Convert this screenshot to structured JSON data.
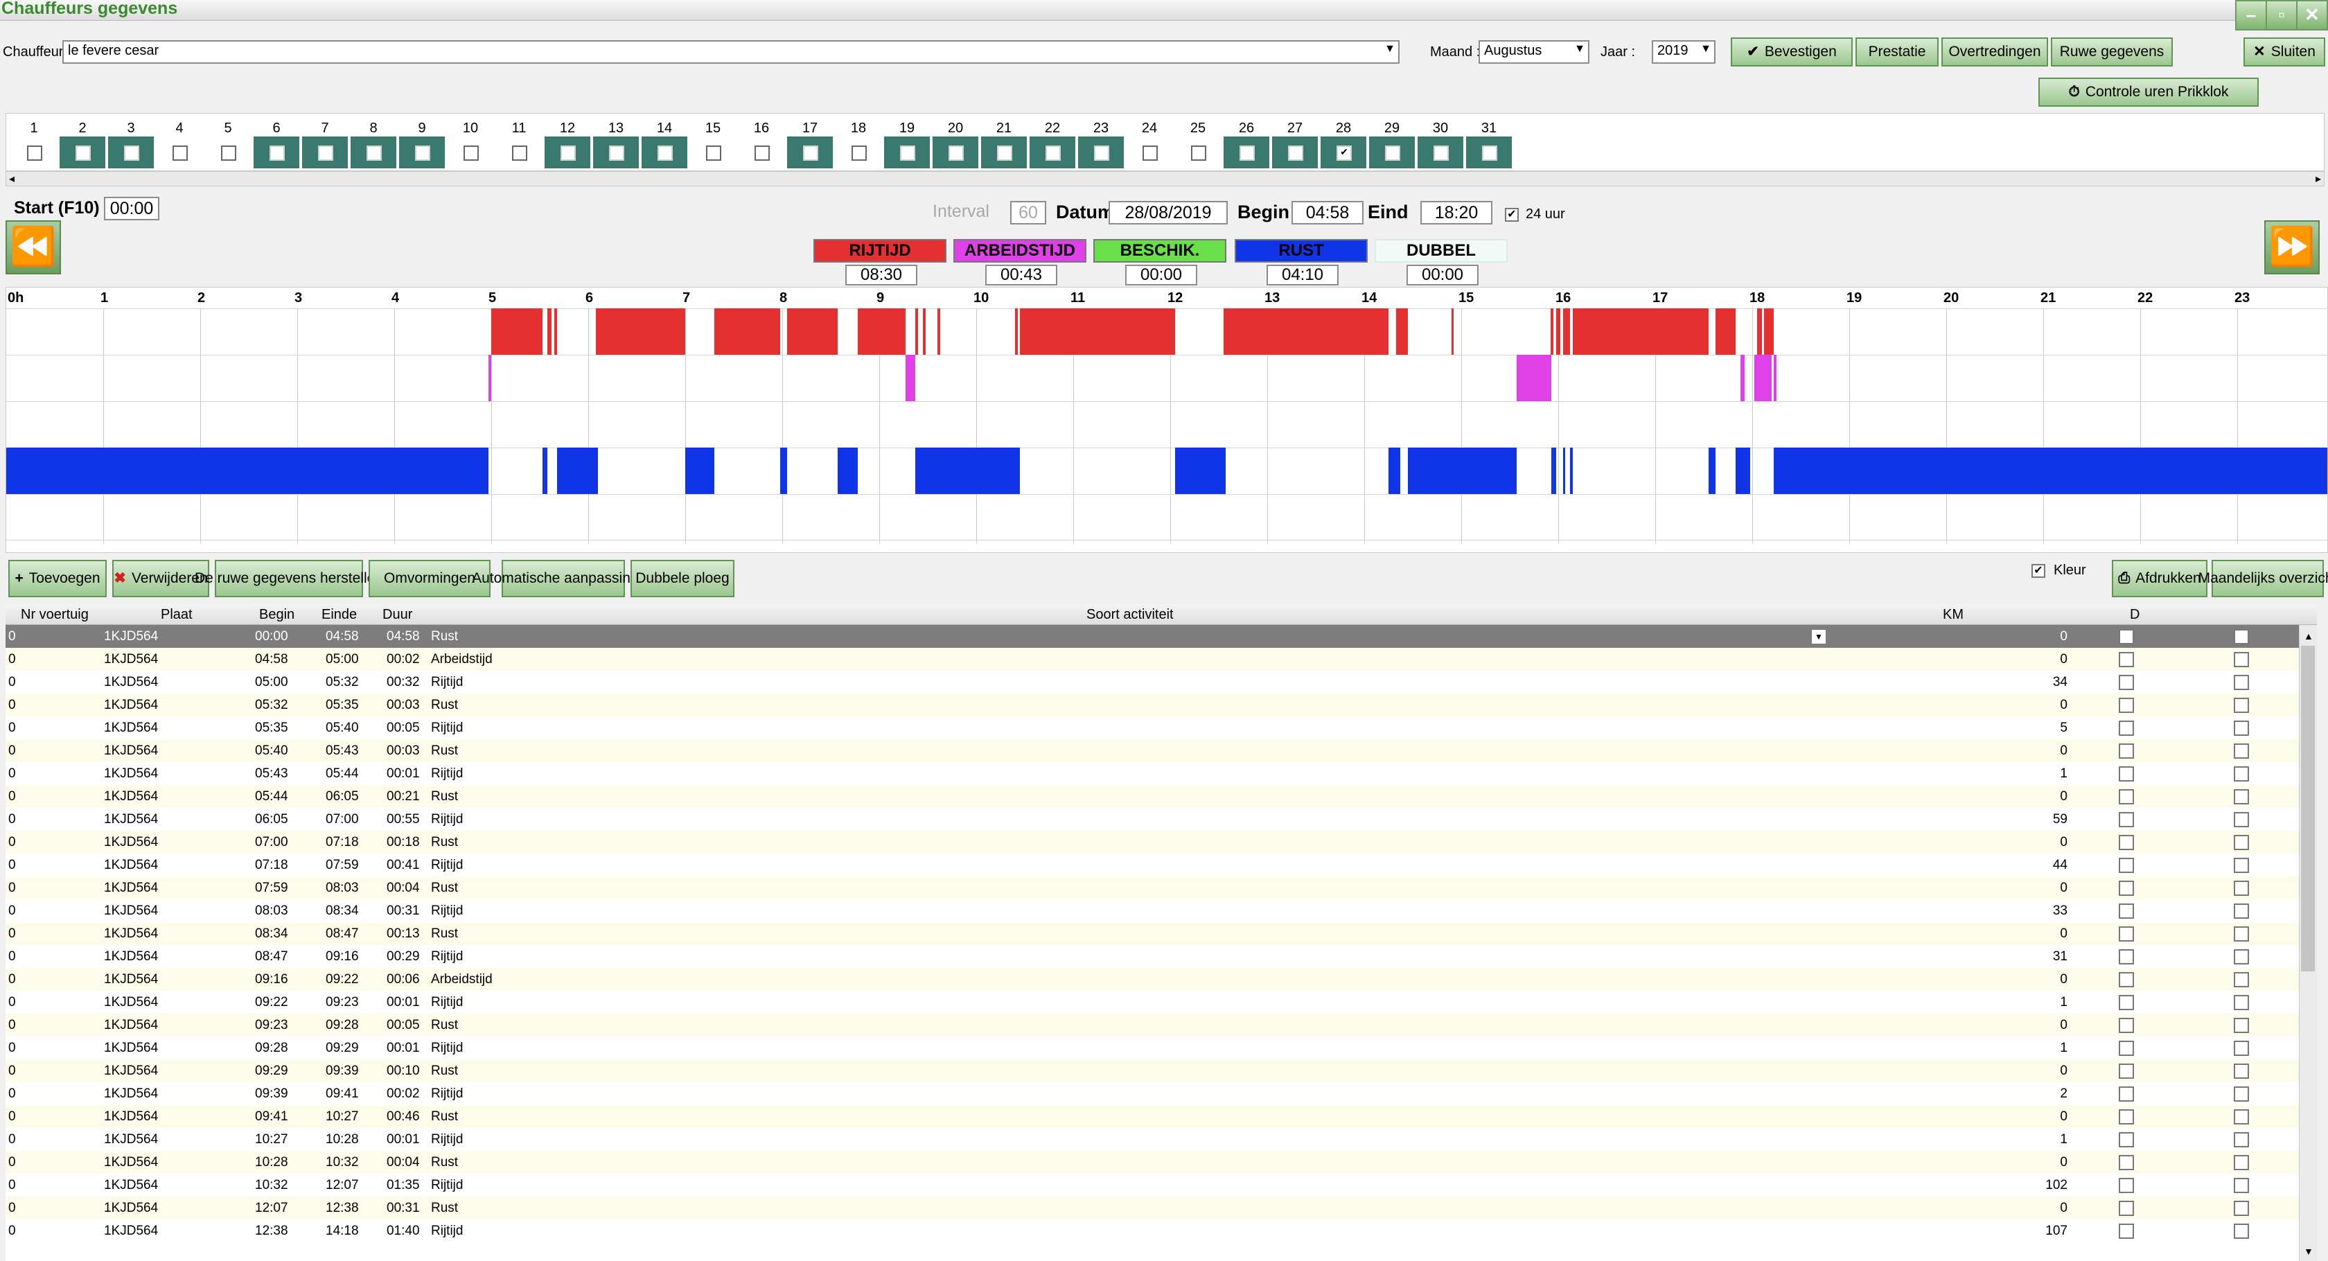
{
  "window": {
    "title": "Chauffeurs gegevens",
    "min_icon": "minimize-icon",
    "max_icon": "maximize-icon",
    "close_icon": "close-icon"
  },
  "header": {
    "chauffeur_label": "Chauffeur",
    "chauffeur_value": "le fevere cesar",
    "maand_label": "Maand :",
    "maand_value": "Augustus",
    "jaar_label": "Jaar :",
    "jaar_value": "2019",
    "btn_bevestigen": "Bevestigen",
    "btn_prestatie": "Prestatie",
    "btn_overtredingen": "Overtredingen",
    "btn_ruwe": "Ruwe gegevens",
    "btn_sluiten": "Sluiten",
    "btn_controle": "Controle uren Prikklok"
  },
  "days": [
    {
      "n": "1",
      "on": false
    },
    {
      "n": "2",
      "on": true
    },
    {
      "n": "3",
      "on": true
    },
    {
      "n": "4",
      "on": false
    },
    {
      "n": "5",
      "on": false
    },
    {
      "n": "6",
      "on": true
    },
    {
      "n": "7",
      "on": true
    },
    {
      "n": "8",
      "on": true
    },
    {
      "n": "9",
      "on": true
    },
    {
      "n": "10",
      "on": false
    },
    {
      "n": "11",
      "on": false
    },
    {
      "n": "12",
      "on": true
    },
    {
      "n": "13",
      "on": true
    },
    {
      "n": "14",
      "on": true
    },
    {
      "n": "15",
      "on": false
    },
    {
      "n": "16",
      "on": false
    },
    {
      "n": "17",
      "on": true
    },
    {
      "n": "18",
      "on": false
    },
    {
      "n": "19",
      "on": true
    },
    {
      "n": "20",
      "on": true
    },
    {
      "n": "21",
      "on": true
    },
    {
      "n": "22",
      "on": true
    },
    {
      "n": "23",
      "on": true
    },
    {
      "n": "24",
      "on": false
    },
    {
      "n": "25",
      "on": false
    },
    {
      "n": "26",
      "on": true
    },
    {
      "n": "27",
      "on": true
    },
    {
      "n": "28",
      "on": true,
      "checked": true
    },
    {
      "n": "29",
      "on": true
    },
    {
      "n": "30",
      "on": true
    },
    {
      "n": "31",
      "on": true
    }
  ],
  "controls": {
    "start_label": "Start (F10)",
    "start_value": "00:00",
    "interval_label": "Interval",
    "interval_value": "60",
    "datum_label": "Datum",
    "datum_value": "28/08/2019",
    "begin_label": "Begin",
    "begin_value": "04:58",
    "eind_label": "Eind",
    "eind_value": "18:20",
    "uur24_label": "24 uur",
    "uur24_checked": true
  },
  "legend": [
    {
      "label": "RIJTIJD",
      "value": "08:30",
      "color": "#e43030"
    },
    {
      "label": "ARBEIDSTIJD",
      "value": "00:43",
      "color": "#e040e8"
    },
    {
      "label": "BESCHIK.",
      "value": "00:00",
      "color": "#69e04a"
    },
    {
      "label": "RUST",
      "value": "04:10",
      "color": "#1034e8"
    },
    {
      "label": "DUBBEL",
      "value": "00:00",
      "color": "#f2faf8"
    }
  ],
  "timeline": {
    "hour_labels": [
      "0h",
      "1",
      "2",
      "3",
      "4",
      "5",
      "6",
      "7",
      "8",
      "9",
      "10",
      "11",
      "12",
      "13",
      "14",
      "15",
      "16",
      "17",
      "18",
      "19",
      "20",
      "21",
      "22",
      "23"
    ],
    "drive": [
      [
        5.0,
        5.53
      ],
      [
        5.58,
        5.62
      ],
      [
        5.65,
        5.68
      ],
      [
        6.08,
        7.0
      ],
      [
        7.3,
        7.98
      ],
      [
        8.05,
        8.57
      ],
      [
        8.78,
        9.27
      ],
      [
        9.37,
        9.4
      ],
      [
        9.45,
        9.48
      ],
      [
        9.6,
        9.63
      ],
      [
        10.4,
        10.43
      ],
      [
        10.45,
        12.05
      ],
      [
        12.55,
        14.25
      ],
      [
        14.33,
        14.45
      ],
      [
        14.9,
        14.92
      ],
      [
        15.92,
        15.95
      ],
      [
        15.98,
        16.02
      ],
      [
        16.05,
        16.12
      ],
      [
        16.15,
        17.55
      ],
      [
        17.62,
        17.83
      ],
      [
        18.05,
        18.1
      ],
      [
        18.12,
        18.22
      ]
    ],
    "work": [
      [
        4.97,
        5.0
      ],
      [
        9.27,
        9.37
      ],
      [
        15.57,
        15.93
      ],
      [
        17.88,
        17.92
      ],
      [
        18.02,
        18.2
      ],
      [
        18.22,
        18.25
      ]
    ],
    "rest": [
      [
        0.0,
        4.97
      ],
      [
        5.53,
        5.58
      ],
      [
        5.68,
        6.1
      ],
      [
        7.0,
        7.3
      ],
      [
        7.98,
        8.05
      ],
      [
        8.57,
        8.78
      ],
      [
        9.37,
        9.65
      ],
      [
        9.65,
        10.45
      ],
      [
        12.05,
        12.57
      ],
      [
        14.25,
        14.37
      ],
      [
        14.45,
        15.57
      ],
      [
        15.93,
        15.98
      ],
      [
        16.05,
        16.07
      ],
      [
        16.12,
        16.15
      ],
      [
        17.55,
        17.62
      ],
      [
        17.83,
        17.98
      ],
      [
        18.22,
        24.0
      ]
    ]
  },
  "actions": {
    "toevoegen": "Toevoegen",
    "verwijderen": "Verwijderen",
    "ruwe_herstellen": "De ruwe gegevens herstellen",
    "omvormingen": "Omvormingen",
    "automatische": "Automatische aanpassingen",
    "dubbele": "Dubbele ploeg",
    "kleur_label": "Kleur",
    "afdrukken": "Afdrukken",
    "maandelijks": "Maandelijks overzicht"
  },
  "table": {
    "headers": {
      "nr": "Nr voertuig",
      "plaat": "Plaat",
      "begin": "Begin",
      "einde": "Einde",
      "duur": "Duur",
      "soort": "Soort activiteit",
      "km": "KM",
      "d": "D"
    },
    "rows": [
      {
        "nr": "0",
        "plaat": "1KJD564",
        "begin": "00:00",
        "einde": "04:58",
        "duur": "04:58",
        "soort": "Rust",
        "km": "0"
      },
      {
        "nr": "0",
        "plaat": "1KJD564",
        "begin": "04:58",
        "einde": "05:00",
        "duur": "00:02",
        "soort": "Arbeidstijd",
        "km": "0"
      },
      {
        "nr": "0",
        "plaat": "1KJD564",
        "begin": "05:00",
        "einde": "05:32",
        "duur": "00:32",
        "soort": "Rijtijd",
        "km": "34"
      },
      {
        "nr": "0",
        "plaat": "1KJD564",
        "begin": "05:32",
        "einde": "05:35",
        "duur": "00:03",
        "soort": "Rust",
        "km": "0"
      },
      {
        "nr": "0",
        "plaat": "1KJD564",
        "begin": "05:35",
        "einde": "05:40",
        "duur": "00:05",
        "soort": "Rijtijd",
        "km": "5"
      },
      {
        "nr": "0",
        "plaat": "1KJD564",
        "begin": "05:40",
        "einde": "05:43",
        "duur": "00:03",
        "soort": "Rust",
        "km": "0"
      },
      {
        "nr": "0",
        "plaat": "1KJD564",
        "begin": "05:43",
        "einde": "05:44",
        "duur": "00:01",
        "soort": "Rijtijd",
        "km": "1"
      },
      {
        "nr": "0",
        "plaat": "1KJD564",
        "begin": "05:44",
        "einde": "06:05",
        "duur": "00:21",
        "soort": "Rust",
        "km": "0"
      },
      {
        "nr": "0",
        "plaat": "1KJD564",
        "begin": "06:05",
        "einde": "07:00",
        "duur": "00:55",
        "soort": "Rijtijd",
        "km": "59"
      },
      {
        "nr": "0",
        "plaat": "1KJD564",
        "begin": "07:00",
        "einde": "07:18",
        "duur": "00:18",
        "soort": "Rust",
        "km": "0"
      },
      {
        "nr": "0",
        "plaat": "1KJD564",
        "begin": "07:18",
        "einde": "07:59",
        "duur": "00:41",
        "soort": "Rijtijd",
        "km": "44"
      },
      {
        "nr": "0",
        "plaat": "1KJD564",
        "begin": "07:59",
        "einde": "08:03",
        "duur": "00:04",
        "soort": "Rust",
        "km": "0"
      },
      {
        "nr": "0",
        "plaat": "1KJD564",
        "begin": "08:03",
        "einde": "08:34",
        "duur": "00:31",
        "soort": "Rijtijd",
        "km": "33"
      },
      {
        "nr": "0",
        "plaat": "1KJD564",
        "begin": "08:34",
        "einde": "08:47",
        "duur": "00:13",
        "soort": "Rust",
        "km": "0"
      },
      {
        "nr": "0",
        "plaat": "1KJD564",
        "begin": "08:47",
        "einde": "09:16",
        "duur": "00:29",
        "soort": "Rijtijd",
        "km": "31"
      },
      {
        "nr": "0",
        "plaat": "1KJD564",
        "begin": "09:16",
        "einde": "09:22",
        "duur": "00:06",
        "soort": "Arbeidstijd",
        "km": "0"
      },
      {
        "nr": "0",
        "plaat": "1KJD564",
        "begin": "09:22",
        "einde": "09:23",
        "duur": "00:01",
        "soort": "Rijtijd",
        "km": "1"
      },
      {
        "nr": "0",
        "plaat": "1KJD564",
        "begin": "09:23",
        "einde": "09:28",
        "duur": "00:05",
        "soort": "Rust",
        "km": "0"
      },
      {
        "nr": "0",
        "plaat": "1KJD564",
        "begin": "09:28",
        "einde": "09:29",
        "duur": "00:01",
        "soort": "Rijtijd",
        "km": "1"
      },
      {
        "nr": "0",
        "plaat": "1KJD564",
        "begin": "09:29",
        "einde": "09:39",
        "duur": "00:10",
        "soort": "Rust",
        "km": "0"
      },
      {
        "nr": "0",
        "plaat": "1KJD564",
        "begin": "09:39",
        "einde": "09:41",
        "duur": "00:02",
        "soort": "Rijtijd",
        "km": "2"
      },
      {
        "nr": "0",
        "plaat": "1KJD564",
        "begin": "09:41",
        "einde": "10:27",
        "duur": "00:46",
        "soort": "Rust",
        "km": "0"
      },
      {
        "nr": "0",
        "plaat": "1KJD564",
        "begin": "10:27",
        "einde": "10:28",
        "duur": "00:01",
        "soort": "Rijtijd",
        "km": "1"
      },
      {
        "nr": "0",
        "plaat": "1KJD564",
        "begin": "10:28",
        "einde": "10:32",
        "duur": "00:04",
        "soort": "Rust",
        "km": "0"
      },
      {
        "nr": "0",
        "plaat": "1KJD564",
        "begin": "10:32",
        "einde": "12:07",
        "duur": "01:35",
        "soort": "Rijtijd",
        "km": "102"
      },
      {
        "nr": "0",
        "plaat": "1KJD564",
        "begin": "12:07",
        "einde": "12:38",
        "duur": "00:31",
        "soort": "Rust",
        "km": "0"
      },
      {
        "nr": "0",
        "plaat": "1KJD564",
        "begin": "12:38",
        "einde": "14:18",
        "duur": "01:40",
        "soort": "Rijtijd",
        "km": "107"
      }
    ]
  }
}
